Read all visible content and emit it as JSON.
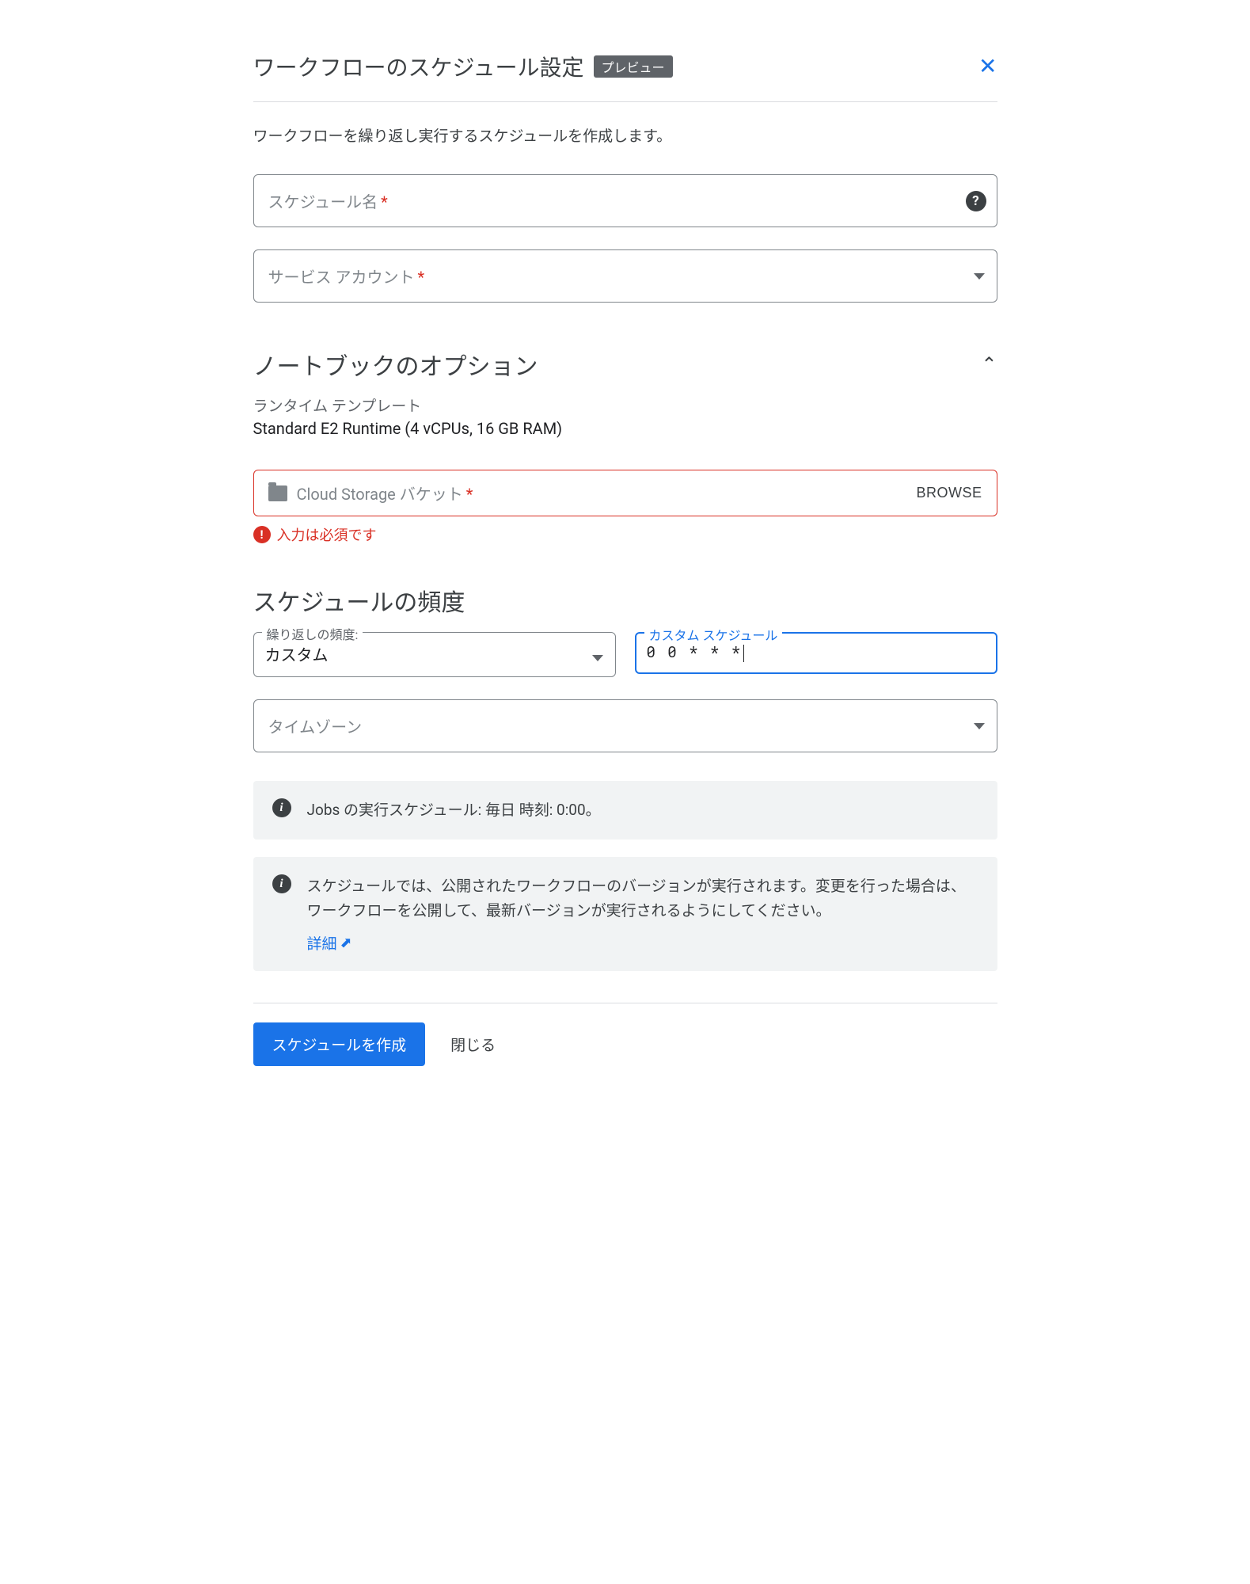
{
  "dialog": {
    "title": "ワークフローのスケジュール設定",
    "badge": "プレビュー",
    "description": "ワークフローを繰り返し実行するスケジュールを作成します。"
  },
  "fields": {
    "schedule_name": {
      "placeholder": "スケジュール名",
      "required_mark": "*"
    },
    "service_account": {
      "placeholder": "サービス アカウント",
      "required_mark": "*"
    },
    "storage_bucket": {
      "placeholder": "Cloud Storage バケット",
      "required_mark": "*",
      "browse_label": "BROWSE",
      "error_message": "入力は必須です"
    },
    "frequency": {
      "legend": "繰り返しの頻度:",
      "value": "カスタム"
    },
    "custom_schedule": {
      "legend": "カスタム スケジュール",
      "value": "0 0 * * *"
    },
    "timezone": {
      "placeholder": "タイムゾーン"
    }
  },
  "sections": {
    "notebook_options": {
      "title": "ノートブックのオプション",
      "runtime_template_label": "ランタイム テンプレート",
      "runtime_template_value": "Standard E2 Runtime (4 vCPUs, 16 GB RAM)"
    },
    "schedule_frequency": {
      "title": "スケジュールの頻度"
    }
  },
  "info_boxes": {
    "schedule_summary": "Jobs の実行スケジュール: 毎日 時刻: 0:00。",
    "version_notice": "スケジュールでは、公開されたワークフローのバージョンが実行されます。変更を行った場合は、ワークフローを公開して、最新バージョンが実行されるようにしてください。",
    "learn_more_label": "詳細"
  },
  "footer": {
    "create_label": "スケジュールを作成",
    "close_label": "閉じる"
  }
}
